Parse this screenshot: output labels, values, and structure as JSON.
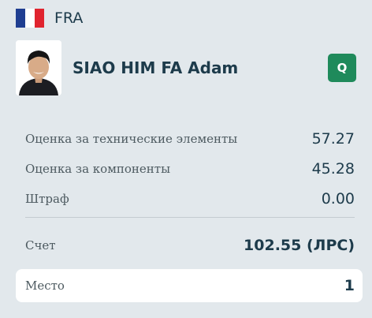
{
  "country": {
    "code": "FRA",
    "flag_colors": [
      "#1f3e91",
      "#ffffff",
      "#e0242f"
    ]
  },
  "athlete": {
    "name": "SIAO HIM FA Adam",
    "q_badge": "Q",
    "q_color": "#1f8a5b"
  },
  "scores": {
    "tes_label": "Оценка за технические элементы",
    "tes_value": "57.27",
    "pcs_label": "Оценка за компоненты",
    "pcs_value": "45.28",
    "deduction_label": "Штраф",
    "deduction_value": "0.00",
    "total_label": "Счет",
    "total_value": "102.55 (ЛРС)",
    "rank_label": "Место",
    "rank_value": "1"
  }
}
